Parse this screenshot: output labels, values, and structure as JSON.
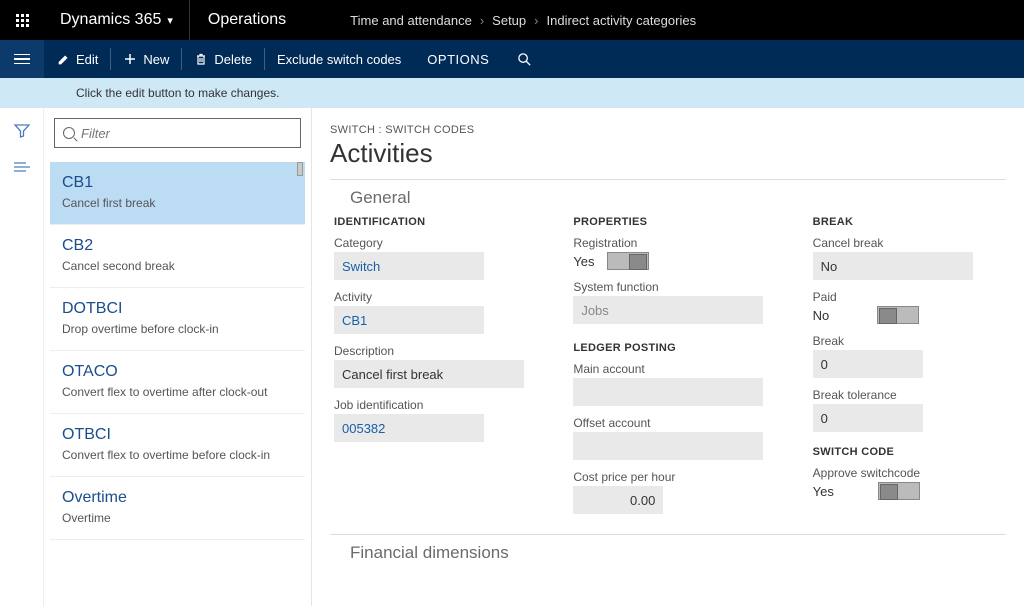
{
  "topbar": {
    "brand": "Dynamics 365",
    "module": "Operations"
  },
  "breadcrumb": {
    "a": "Time and attendance",
    "b": "Setup",
    "c": "Indirect activity categories"
  },
  "cmd": {
    "edit": "Edit",
    "new": "New",
    "delete": "Delete",
    "exclude": "Exclude switch codes",
    "options": "OPTIONS"
  },
  "infobar": "Click the edit button to make changes.",
  "filter": {
    "placeholder": "Filter"
  },
  "list": [
    {
      "code": "CB1",
      "desc": "Cancel first break"
    },
    {
      "code": "CB2",
      "desc": "Cancel second break"
    },
    {
      "code": "DOTBCI",
      "desc": "Drop overtime before clock-in"
    },
    {
      "code": "OTACO",
      "desc": "Convert flex to overtime after clock-out"
    },
    {
      "code": "OTBCI",
      "desc": "Convert flex to overtime before clock-in"
    },
    {
      "code": "Overtime",
      "desc": "Overtime"
    }
  ],
  "detail": {
    "overline": "SWITCH : SWITCH CODES",
    "title": "Activities",
    "section_general": "General",
    "section_fin": "Financial dimensions",
    "groups": {
      "identification": "IDENTIFICATION",
      "properties": "PROPERTIES",
      "ledger": "LEDGER POSTING",
      "break": "BREAK",
      "switchcode": "SWITCH CODE"
    },
    "labels": {
      "category": "Category",
      "activity": "Activity",
      "description": "Description",
      "jobid": "Job identification",
      "registration": "Registration",
      "sysfunc": "System function",
      "mainacct": "Main account",
      "offsetacct": "Offset account",
      "costph": "Cost price per hour",
      "cancelbreak": "Cancel break",
      "paid": "Paid",
      "breakf": "Break",
      "breaktol": "Break tolerance",
      "approvesc": "Approve switchcode"
    },
    "values": {
      "category": "Switch",
      "activity": "CB1",
      "description": "Cancel first break",
      "jobid": "005382",
      "registration": "Yes",
      "sysfunc": "Jobs",
      "mainacct": "",
      "offsetacct": "",
      "costph": "0.00",
      "cancelbreak": "No",
      "paid": "No",
      "breakf": "0",
      "breaktol": "0",
      "approvesc": "Yes"
    }
  }
}
